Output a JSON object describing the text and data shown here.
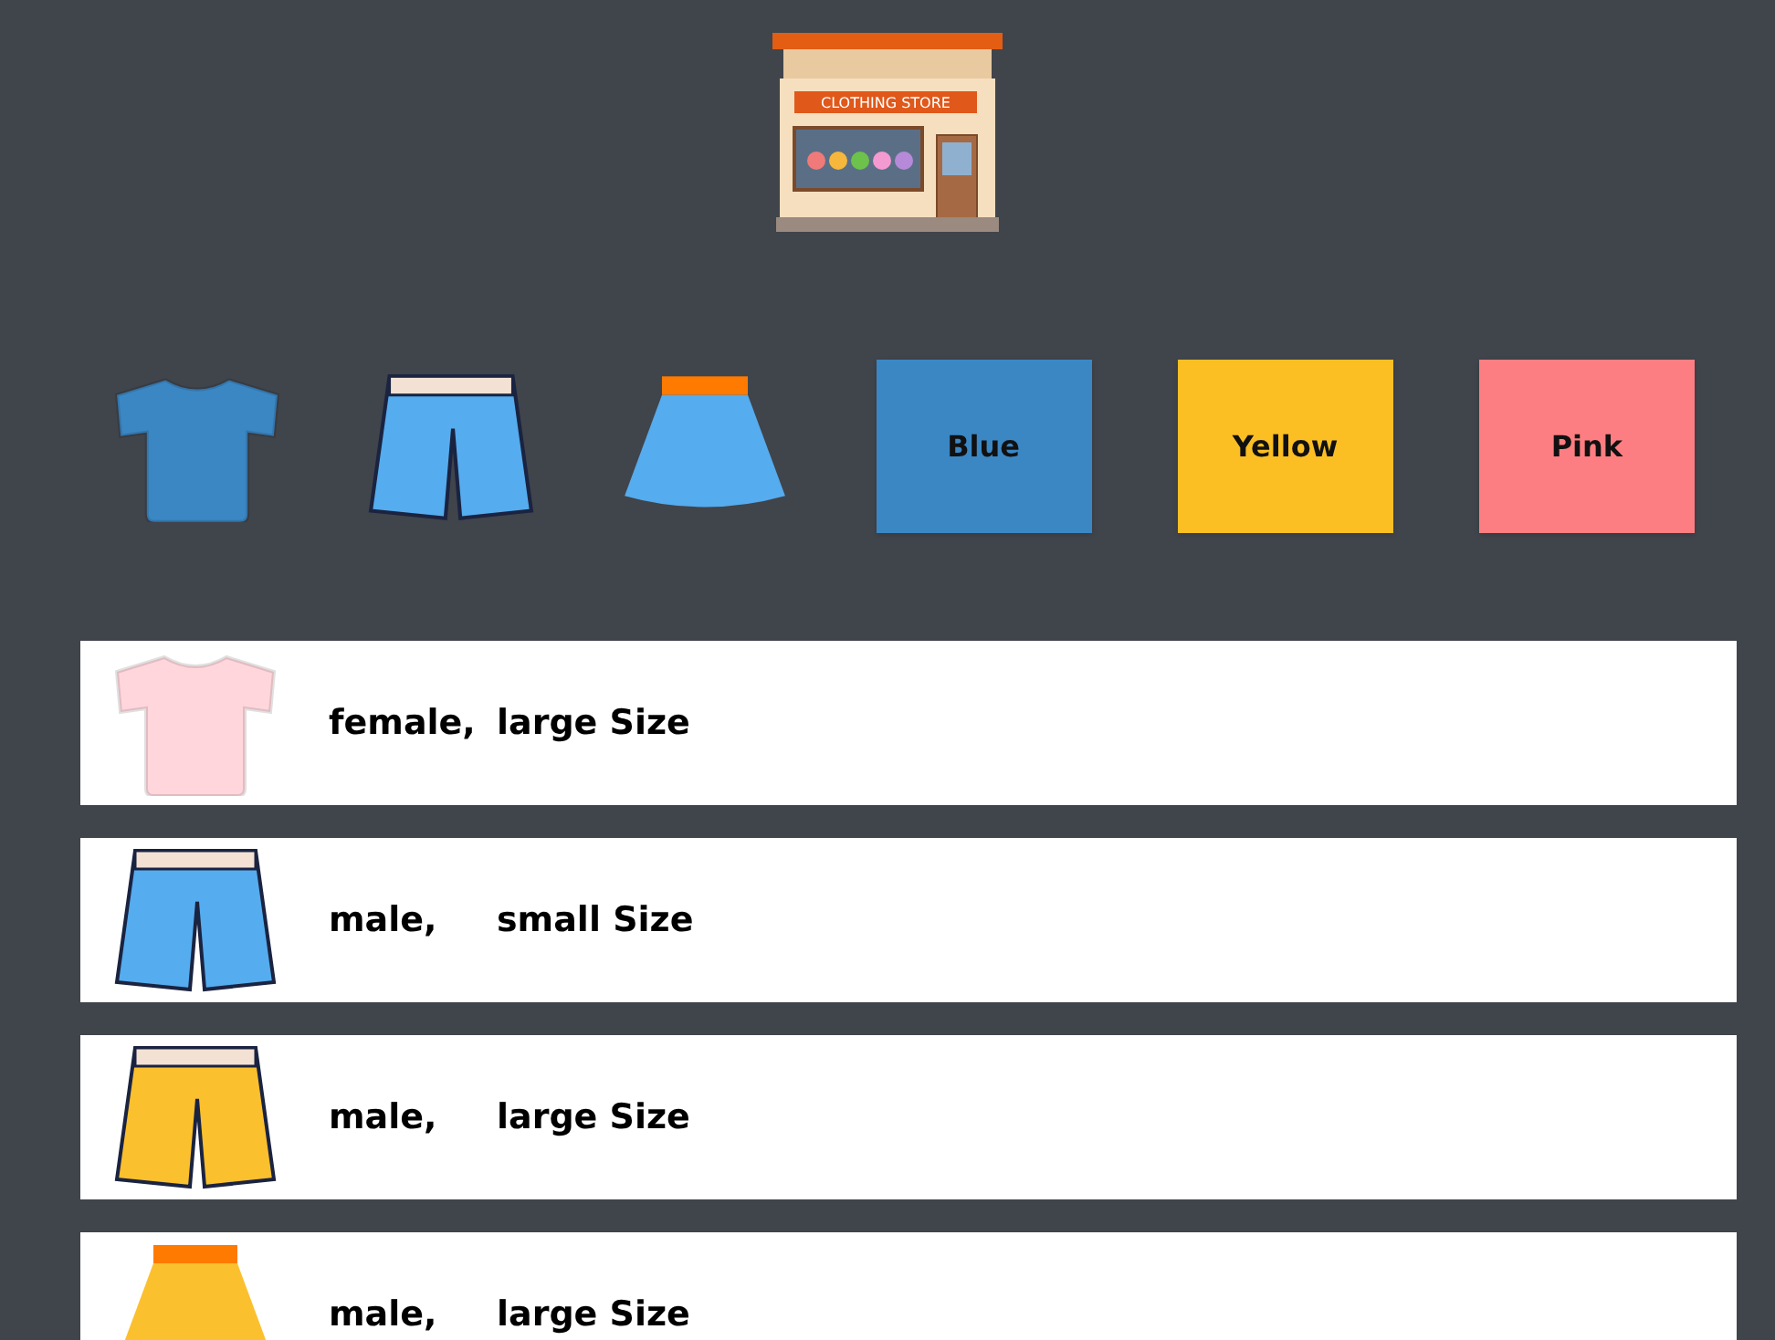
{
  "store": {
    "sign": "CLOTHING STORE"
  },
  "filters": [
    {
      "kind": "shirt",
      "color": "#3b87c4"
    },
    {
      "kind": "shorts",
      "color": "#55acee"
    },
    {
      "kind": "skirt",
      "color": "#55acee"
    },
    {
      "kind": "swatch",
      "label": "Blue",
      "color": "#3b87c4"
    },
    {
      "kind": "swatch",
      "label": "Yellow",
      "color": "#fbbf24"
    },
    {
      "kind": "swatch",
      "label": "Pink",
      "color": "#fd7e82"
    }
  ],
  "items": [
    {
      "kind": "shirt",
      "color": "#ffd6dc",
      "gender": "female,",
      "size": "large Size"
    },
    {
      "kind": "shorts",
      "color": "#55acee",
      "gender": "male,",
      "size": "small Size"
    },
    {
      "kind": "shorts",
      "color": "#fbc02d",
      "gender": "male,",
      "size": "large Size"
    },
    {
      "kind": "skirt",
      "color": "#fbc02d",
      "gender": "male,",
      "size": "large Size"
    }
  ]
}
